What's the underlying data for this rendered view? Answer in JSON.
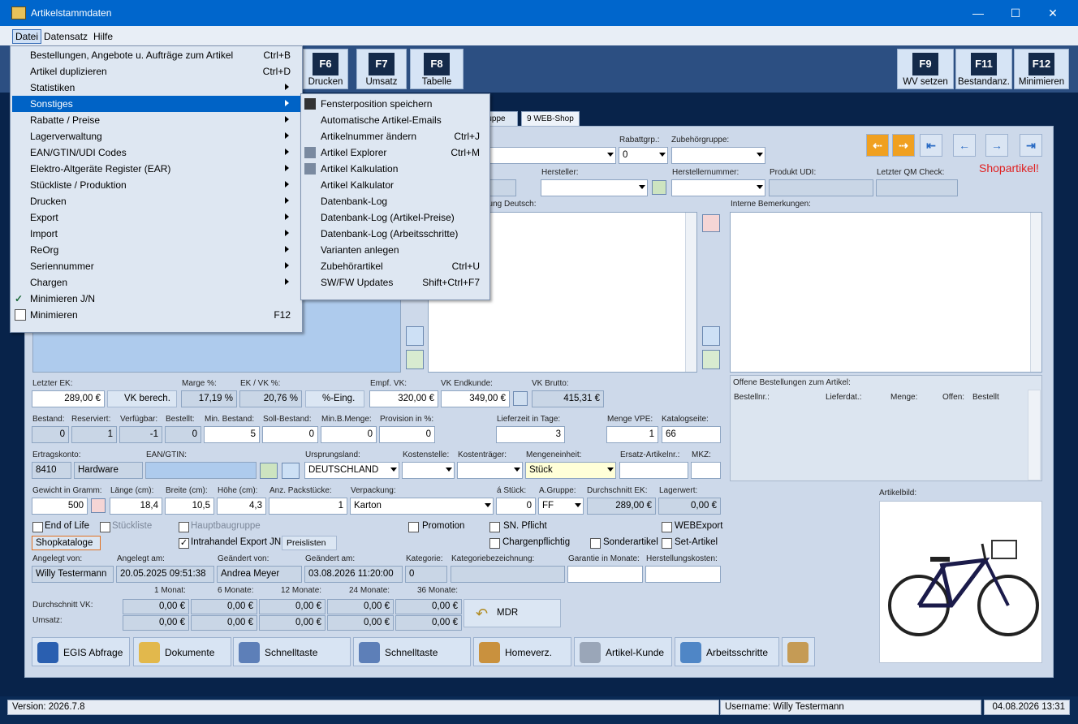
{
  "window": {
    "title": "Artikelstammdaten",
    "minimize": "—",
    "maximize": "☐",
    "close": "✕"
  },
  "menubar": [
    "Datei",
    "Datensatz",
    "Hilfe"
  ],
  "toolbar": [
    {
      "key": "F6",
      "label": "Drucken"
    },
    {
      "key": "F7",
      "label": "Umsatz"
    },
    {
      "key": "F8",
      "label": "Tabelle"
    },
    {
      "key": "F9",
      "label": "WV setzen"
    },
    {
      "key": "F11",
      "label": "Bestandanz."
    },
    {
      "key": "F12",
      "label": "Minimieren"
    }
  ],
  "tabs": [
    "ruppe",
    "9 WEB-Shop"
  ],
  "datei_menu": [
    {
      "label": "Bestellungen, Angebote u. Aufträge zum Artikel",
      "shortcut": "Ctrl+B"
    },
    {
      "label": "Artikel duplizieren",
      "shortcut": "Ctrl+D"
    },
    {
      "label": "Statistiken",
      "submenu": true
    },
    {
      "label": "Sonstiges",
      "submenu": true,
      "highlight": true
    },
    {
      "label": "Rabatte / Preise",
      "submenu": true
    },
    {
      "label": "Lagerverwaltung",
      "submenu": true
    },
    {
      "label": "EAN/GTIN/UDI Codes",
      "submenu": true
    },
    {
      "label": "Elektro-Altgeräte Register (EAR)",
      "submenu": true
    },
    {
      "label": "Stückliste / Produktion",
      "submenu": true
    },
    {
      "label": "Drucken",
      "submenu": true
    },
    {
      "label": "Export",
      "submenu": true
    },
    {
      "label": "Import",
      "submenu": true
    },
    {
      "label": "ReOrg",
      "submenu": true
    },
    {
      "label": "Seriennummer",
      "submenu": true
    },
    {
      "label": "Chargen",
      "submenu": true
    },
    {
      "label": "Minimieren J/N",
      "checked": true
    },
    {
      "label": "Minimieren",
      "shortcut": "F12"
    }
  ],
  "sonstiges_menu": [
    {
      "label": "Fensterposition speichern",
      "shortcut": ""
    },
    {
      "label": "Automatische Artikel-Emails",
      "shortcut": ""
    },
    {
      "label": "Artikelnummer ändern",
      "shortcut": "Ctrl+J"
    },
    {
      "label": "Artikel Explorer",
      "shortcut": "Ctrl+M"
    },
    {
      "label": "Artikel Kalkulation",
      "shortcut": ""
    },
    {
      "label": "Artikel Kalkulator",
      "shortcut": ""
    },
    {
      "label": "Datenbank-Log",
      "shortcut": ""
    },
    {
      "label": "Datenbank-Log (Artikel-Preise)",
      "shortcut": ""
    },
    {
      "label": "Datenbank-Log (Arbeitsschritte)",
      "shortcut": ""
    },
    {
      "label": "Varianten anlegen",
      "shortcut": ""
    },
    {
      "label": "Zubehörartikel",
      "shortcut": "Ctrl+U"
    },
    {
      "label": "SW/FW Updates",
      "shortcut": "Shift+Ctrl+F7"
    }
  ],
  "top": {
    "rabattgrp_label": "Rabattgrp.:",
    "rabattgrp": "0",
    "zubehoer_label": "Zubehörgruppe:",
    "hersteller_label": "Hersteller:",
    "herstellernr_label": "Herstellernummer:",
    "udi_label": "Produkt UDI:",
    "qm_label": "Letzter QM Check:",
    "shopartikel": "Shopartikel!",
    "beschr_label": "bung Deutsch:",
    "bemerk_label": "Interne Bemerkungen:"
  },
  "prices": {
    "letzter_ek_label": "Letzter EK:",
    "letzter_ek": "289,00 €",
    "vk_berech": "VK berech.",
    "marge_label": "Marge %:",
    "marge": "17,19 %",
    "ekvk_label": "EK / VK %:",
    "ekvk": "20,76 %",
    "prozent_eing": "%-Eing.",
    "empf_vk_label": "Empf. VK:",
    "empf_vk": "320,00 €",
    "vk_end_label": "VK Endkunde:",
    "vk_end": "349,00 €",
    "vk_brutto_label": "VK Brutto:",
    "vk_brutto": "415,31 €"
  },
  "stock": {
    "bestand_label": "Bestand:",
    "bestand": "0",
    "reserviert_label": "Reserviert:",
    "reserviert": "1",
    "verfuegbar_label": "Verfügbar:",
    "verfuegbar": "-1",
    "bestellt_label": "Bestellt:",
    "bestellt": "0",
    "min_label": "Min. Bestand:",
    "min": "5",
    "soll_label": "Soll-Bestand:",
    "soll": "0",
    "minb_label": "Min.B.Menge:",
    "minb": "0",
    "prov_label": "Provision in %:",
    "prov": "0",
    "liefer_label": "Lieferzeit in Tage:",
    "liefer": "3",
    "vpe_label": "Menge VPE:",
    "vpe": "1",
    "katalog_label": "Katalogseite:",
    "katalog": "66"
  },
  "misc": {
    "ertrag_label": "Ertragskonto:",
    "ertrag": "8410",
    "ertrag_name": "Hardware",
    "ean_label": "EAN/GTIN:",
    "ursprung_label": "Ursprungsland:",
    "ursprung": "DEUTSCHLAND",
    "kostenstelle_label": "Kostenstelle:",
    "kostentraeger_label": "Kostenträger:",
    "mengeneinheit_label": "Mengeneinheit:",
    "mengeneinheit": "Stück",
    "ersatz_label": "Ersatz-Artikelnr.:",
    "mkz_label": "MKZ:"
  },
  "dims": {
    "gewicht_label": "Gewicht in Gramm:",
    "gewicht": "500",
    "laenge_label": "Länge (cm):",
    "laenge": "18,4",
    "breite_label": "Breite (cm):",
    "breite": "10,5",
    "hoehe_label": "Höhe (cm):",
    "hoehe": "4,3",
    "pack_label": "Anz. Packstücke:",
    "pack": "1",
    "verpackung_label": "Verpackung:",
    "verpackung": "Karton",
    "astueck_label": "á Stück:",
    "astueck": "0",
    "agruppe_label": "A.Gruppe:",
    "agruppe": "FF",
    "dek_label": "Durchschnitt EK:",
    "dek": "289,00 €",
    "lager_label": "Lagerwert:",
    "lager": "0,00 €"
  },
  "checks": {
    "eol": "End of Life",
    "stueckliste": "Stückliste",
    "haupt": "Hauptbaugruppe",
    "promotion": "Promotion",
    "sn": "SN. Pflicht",
    "webexport": "WEBExport",
    "shopkataloge": "Shopkataloge",
    "intrahandel": "Intrahandel Export JN",
    "preislisten": "Preislisten",
    "charge": "Chargenpflichtig",
    "sonder": "Sonderartikel",
    "set": "Set-Artikel"
  },
  "audit": {
    "angelegt_von_label": "Angelegt von:",
    "angelegt_von": "Willy Testermann",
    "angelegt_am_label": "Angelegt am:",
    "angelegt_am": "20.05.2025 09:51:38",
    "geaendert_von_label": "Geändert von:",
    "geaendert_von": "Andrea Meyer",
    "geaendert_am_label": "Geändert am:",
    "geaendert_am": "03.08.2026 11:20:00",
    "kategorie_label": "Kategorie:",
    "kategorie": "0",
    "katbez_label": "Kategoriebezeichnung:",
    "garantie_label": "Garantie in Monate:",
    "herstellkosten_label": "Herstellungskosten:"
  },
  "stats": {
    "cols": [
      "1 Monat:",
      "6 Monate:",
      "12 Monate:",
      "24 Monate:",
      "36 Monate:"
    ],
    "dvk_label": "Durchschnitt VK:",
    "umsatz_label": "Umsatz:",
    "dvk": [
      "0,00 €",
      "0,00 €",
      "0,00 €",
      "0,00 €",
      "0,00 €"
    ],
    "umsatz": [
      "0,00 €",
      "0,00 €",
      "0,00 €",
      "0,00 €",
      "0,00 €"
    ],
    "mdr": "MDR"
  },
  "bestellungen": {
    "title": "Offene Bestellungen zum Artikel:",
    "cols": [
      "Bestellnr.:",
      "Lieferdat.:",
      "Menge:",
      "Offen:",
      "Bestellt"
    ]
  },
  "artikelbild_label": "Artikelbild:",
  "bottom_buttons": [
    "EGIS Abfrage",
    "Dokumente",
    "Schnelltaste",
    "Schnelltaste",
    "Homeverz.",
    "Artikel-Kunde",
    "Arbeitsschritte"
  ],
  "status": {
    "version": "Version: 2026.7.8",
    "user": "Username: Willy Testermann",
    "datetime": "04.08.2026 13:31"
  }
}
